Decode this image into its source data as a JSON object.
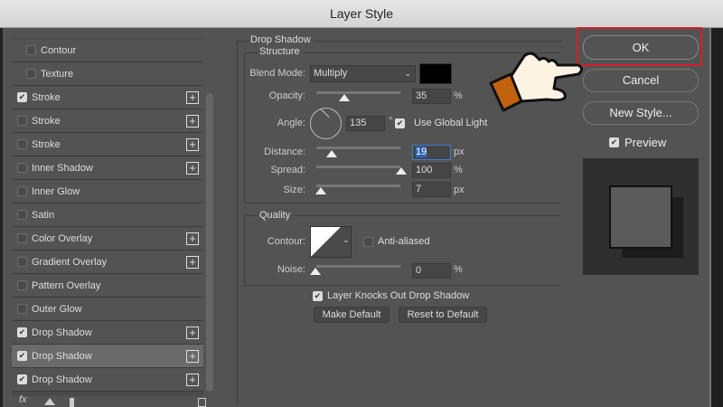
{
  "window": {
    "title": "Layer Style"
  },
  "styles": [
    {
      "label": "Contour",
      "checked": false,
      "indent": true,
      "plus": false
    },
    {
      "label": "Texture",
      "checked": false,
      "indent": true,
      "plus": false
    },
    {
      "label": "Stroke",
      "checked": true,
      "plus": true
    },
    {
      "label": "Stroke",
      "checked": false,
      "plus": true
    },
    {
      "label": "Stroke",
      "checked": false,
      "plus": true
    },
    {
      "label": "Inner Shadow",
      "checked": false,
      "plus": true
    },
    {
      "label": "Inner Glow",
      "checked": false,
      "plus": false
    },
    {
      "label": "Satin",
      "checked": false,
      "plus": false
    },
    {
      "label": "Color Overlay",
      "checked": false,
      "plus": true
    },
    {
      "label": "Gradient Overlay",
      "checked": false,
      "plus": true
    },
    {
      "label": "Pattern Overlay",
      "checked": false,
      "plus": false
    },
    {
      "label": "Outer Glow",
      "checked": false,
      "plus": false
    },
    {
      "label": "Drop Shadow",
      "checked": true,
      "plus": true
    },
    {
      "label": "Drop Shadow",
      "checked": true,
      "plus": true,
      "selected": true
    },
    {
      "label": "Drop Shadow",
      "checked": true,
      "plus": true
    }
  ],
  "footer": {
    "fx": "fx"
  },
  "drop_shadow": {
    "title": "Drop Shadow",
    "structure": "Structure",
    "blend_mode_label": "Blend Mode:",
    "blend_mode": "Multiply",
    "shadow_color": "#000000",
    "opacity_label": "Opacity:",
    "opacity": "35",
    "opacity_unit": "%",
    "angle_label": "Angle:",
    "angle": "135",
    "angle_unit": "°",
    "use_global_light": "Use Global Light",
    "distance_label": "Distance:",
    "distance": "19",
    "distance_unit": "px",
    "spread_label": "Spread:",
    "spread": "100",
    "spread_unit": "%",
    "size_label": "Size:",
    "size": "7",
    "size_unit": "px",
    "quality": "Quality",
    "contour_label": "Contour:",
    "anti_aliased": "Anti-aliased",
    "noise_label": "Noise:",
    "noise": "0",
    "noise_unit": "%",
    "knockout": "Layer Knocks Out Drop Shadow",
    "make_default": "Make Default",
    "reset_default": "Reset to Default"
  },
  "buttons": {
    "ok": "OK",
    "cancel": "Cancel",
    "new_style": "New Style...",
    "preview": "Preview"
  },
  "colors": {
    "highlight": "#d0202a",
    "hand_cuff": "#c0620e"
  }
}
